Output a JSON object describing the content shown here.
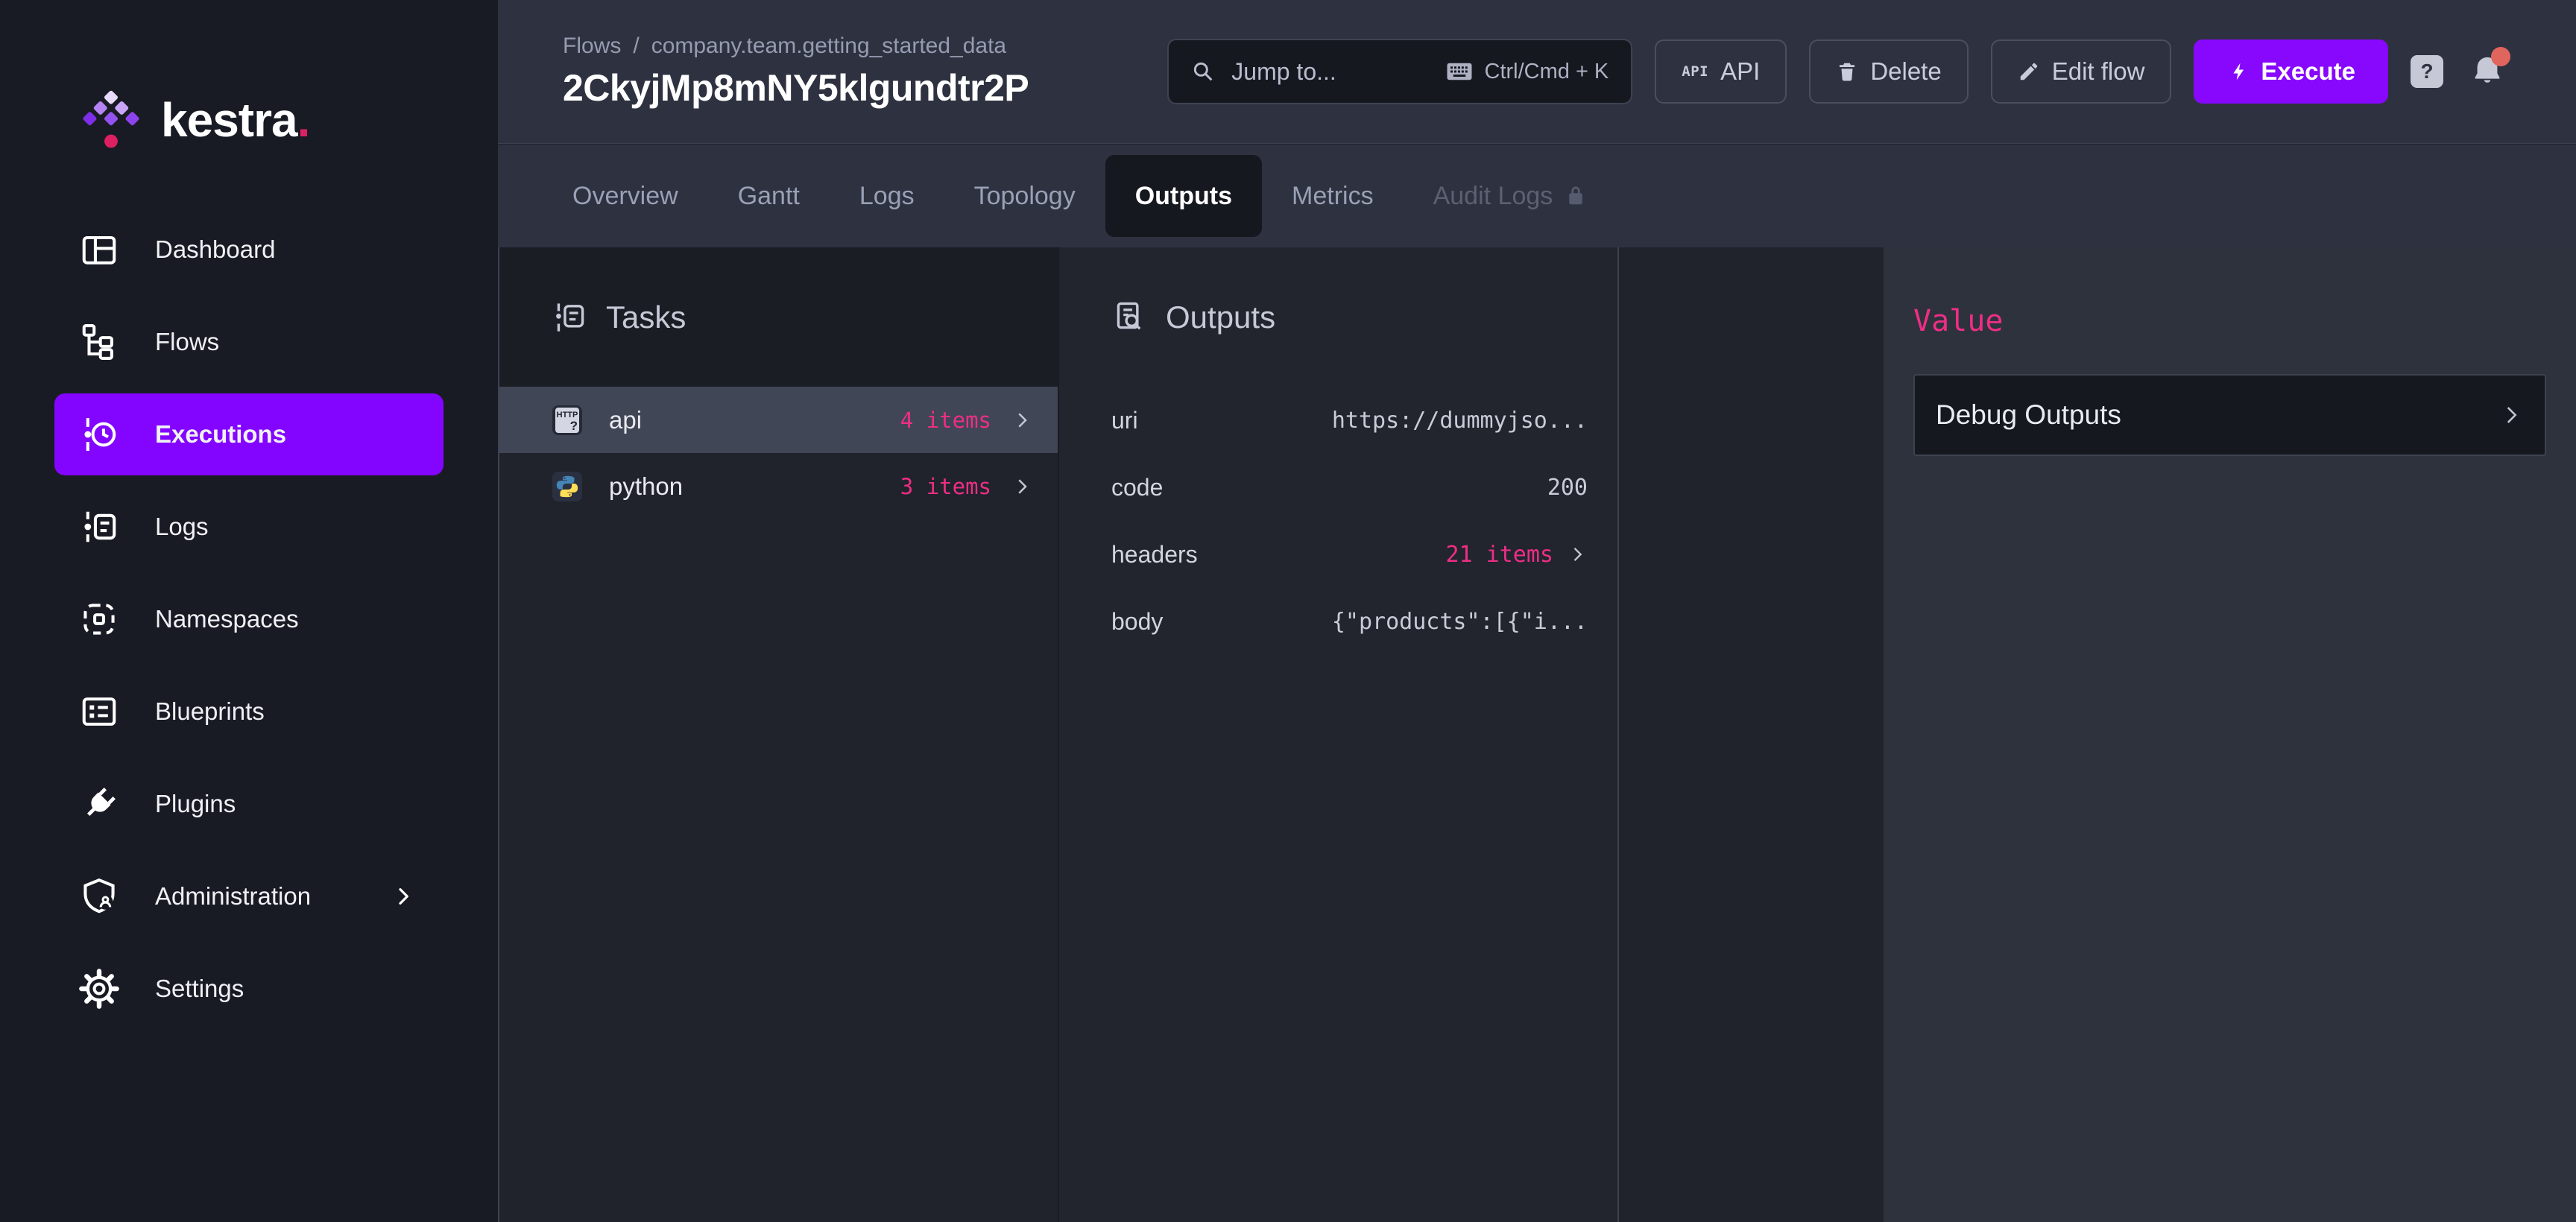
{
  "brand": {
    "name": "kestra",
    "dot": "."
  },
  "sidebar": {
    "active_item": "Executions",
    "items": [
      {
        "label": "Dashboard"
      },
      {
        "label": "Flows"
      },
      {
        "label": "Executions"
      },
      {
        "label": "Logs"
      },
      {
        "label": "Namespaces"
      },
      {
        "label": "Blueprints"
      },
      {
        "label": "Plugins"
      },
      {
        "label": "Administration"
      },
      {
        "label": "Settings"
      }
    ]
  },
  "topbar": {
    "breadcrumb": {
      "root": "Flows",
      "separator": "/",
      "path": "company.team.getting_started_data"
    },
    "title": "2CkyjMp8mNY5klgundtr2P",
    "search": {
      "placeholder": "Jump to...",
      "shortcut": "Ctrl/Cmd + K"
    },
    "buttons": {
      "api": "API",
      "api_glyph": "API",
      "delete": "Delete",
      "edit_flow": "Edit flow",
      "execute": "Execute"
    },
    "help": "?"
  },
  "tabs": {
    "active": "Outputs",
    "locked": "Audit Logs",
    "items": [
      {
        "label": "Overview"
      },
      {
        "label": "Gantt"
      },
      {
        "label": "Logs"
      },
      {
        "label": "Topology"
      },
      {
        "label": "Outputs"
      },
      {
        "label": "Metrics"
      },
      {
        "label": "Audit Logs"
      }
    ]
  },
  "tasks_panel": {
    "title": "Tasks",
    "selected": "api",
    "rows": [
      {
        "name": "api",
        "count": "4 items",
        "badge": "HTTP",
        "badge_q": "?"
      },
      {
        "name": "python",
        "count": "3 items"
      }
    ]
  },
  "outputs_panel": {
    "title": "Outputs",
    "rows": [
      {
        "key": "uri",
        "value": "https://dummyjso..."
      },
      {
        "key": "code",
        "value": "200"
      },
      {
        "key": "headers",
        "value": "21 items"
      },
      {
        "key": "body",
        "value": "{\"products\":[{\"i..."
      }
    ]
  },
  "value_panel": {
    "title": "Value",
    "button": "Debug Outputs"
  },
  "colors": {
    "accent_purple": "#8405ff",
    "accent_pink": "#ee2e85",
    "sidebar_bg": "#191b24",
    "topbar_bg": "#2e3240",
    "panel_bg": "#22252e",
    "selected_row_bg": "#414656",
    "dark_input_bg": "#15181f",
    "notification_dot": "#e0655c",
    "logo_dot_pink": "#de2063"
  },
  "icons": [
    "kestra-logo-icon",
    "dashboard-icon",
    "flows-icon",
    "executions-icon",
    "logs-icon",
    "namespaces-icon",
    "blueprints-icon",
    "plugins-icon",
    "administration-icon",
    "settings-icon",
    "chevron-right-icon",
    "search-icon",
    "keyboard-icon",
    "api-icon",
    "trash-icon",
    "pencil-icon",
    "bolt-icon",
    "help-icon",
    "bell-icon",
    "lock-icon",
    "tasks-icon",
    "outputs-icon",
    "http-request-icon",
    "python-icon"
  ]
}
